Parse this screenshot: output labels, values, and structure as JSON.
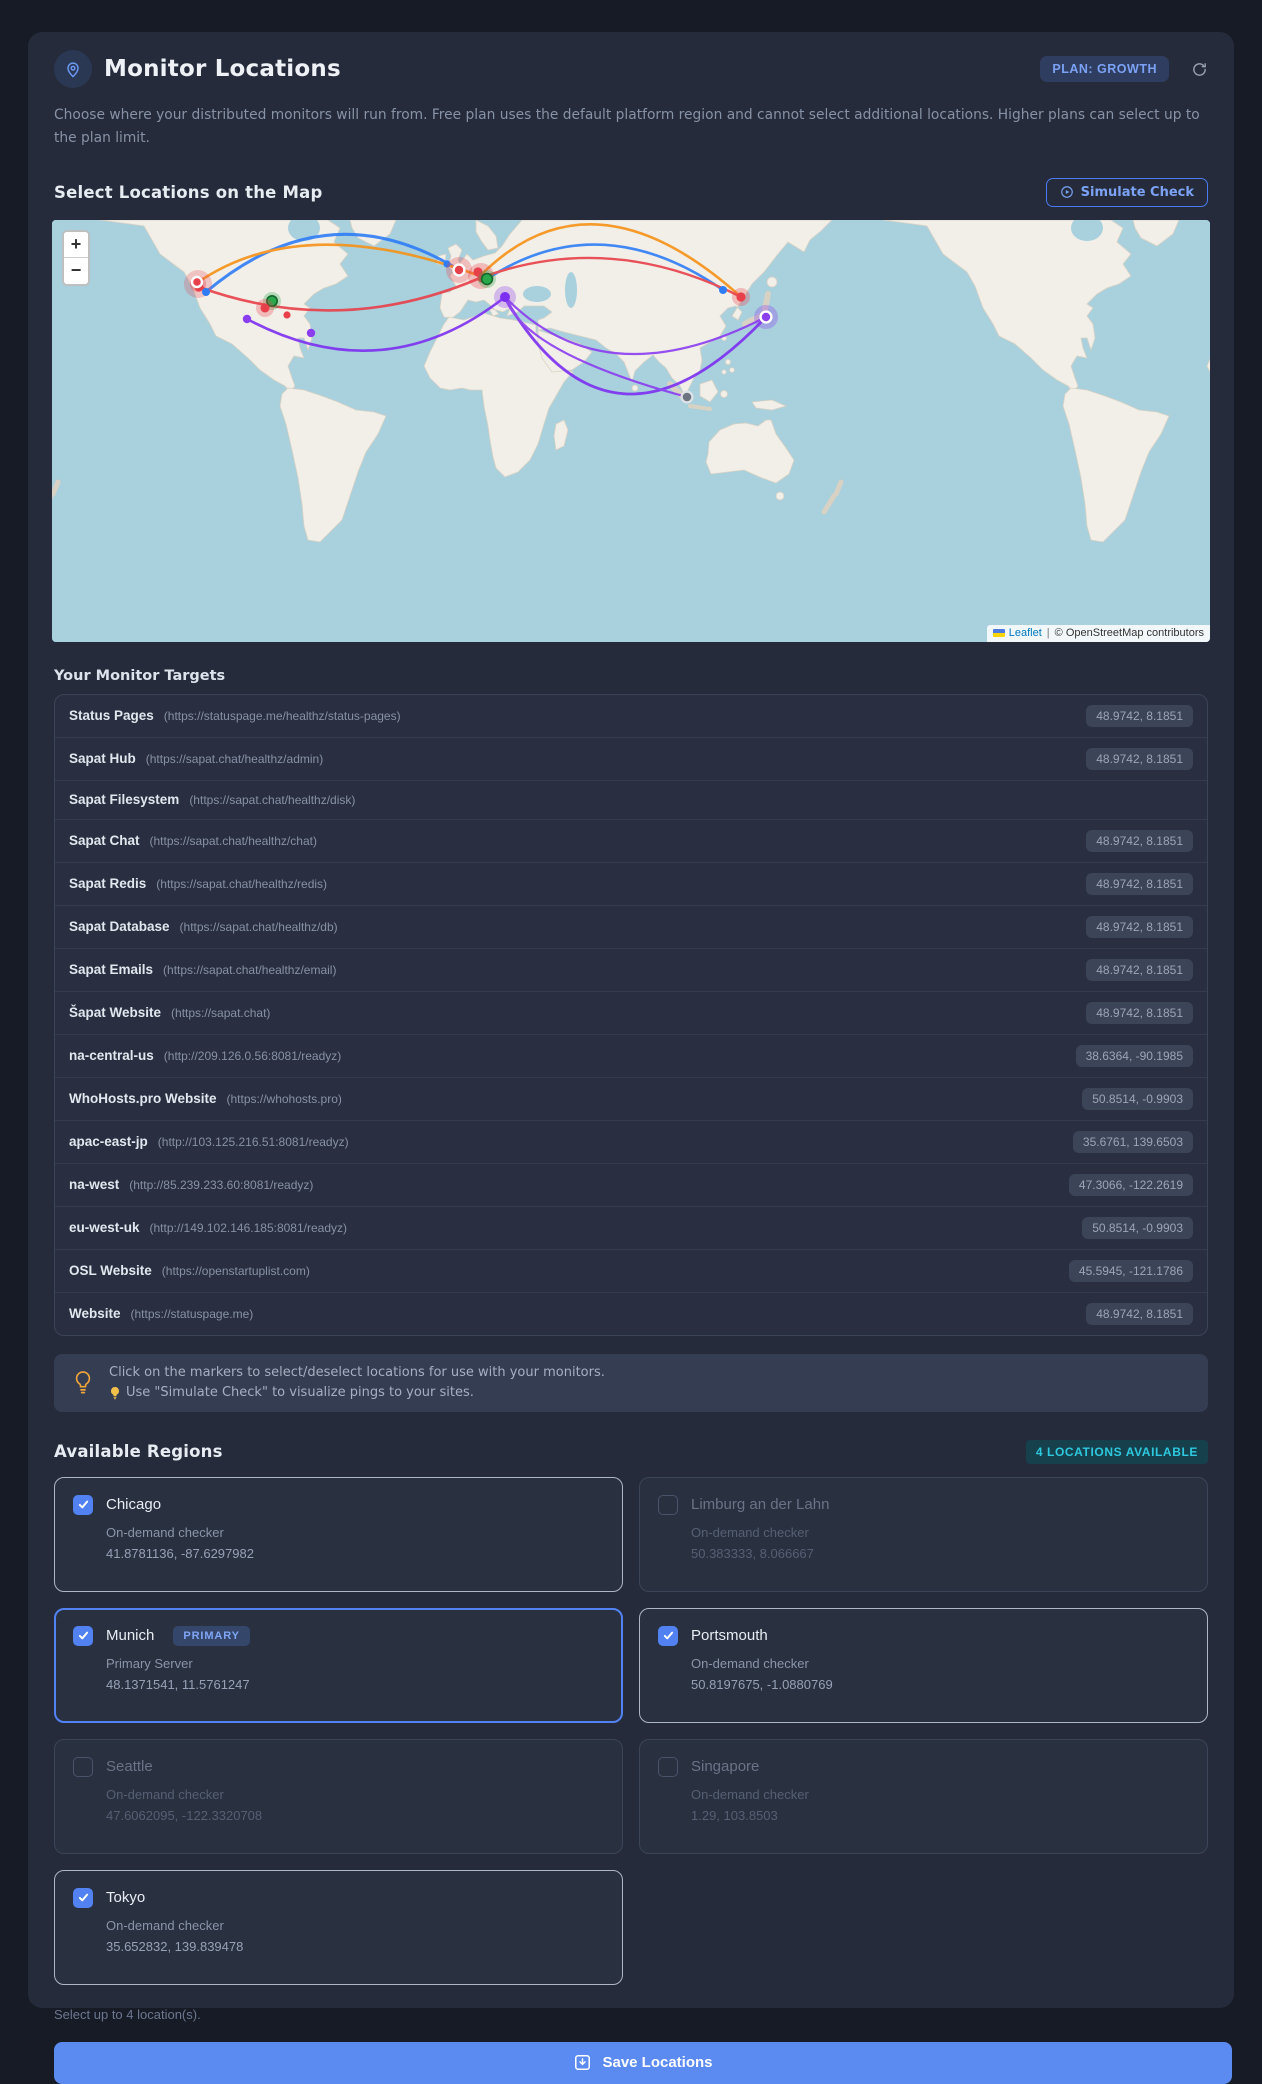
{
  "header": {
    "title": "Monitor Locations",
    "plan_badge": "PLAN: GROWTH",
    "description": "Choose where your distributed monitors will run from. Free plan uses the default platform region and cannot select additional locations. Higher plans can select up to the plan limit."
  },
  "map_section": {
    "heading": "Select Locations on the Map",
    "simulate_button": "Simulate Check",
    "zoom_in": "+",
    "zoom_out": "−",
    "attribution": {
      "leaflet": "Leaflet",
      "separator": "|",
      "osm": "© OpenStreetMap contributors"
    }
  },
  "targets": {
    "heading": "Your Monitor Targets",
    "items": [
      {
        "name": "Status Pages",
        "url": "(https://statuspage.me/healthz/status-pages)",
        "coords": "48.9742, 8.1851"
      },
      {
        "name": "Sapat Hub",
        "url": "(https://sapat.chat/healthz/admin)",
        "coords": "48.9742, 8.1851"
      },
      {
        "name": "Sapat Filesystem",
        "url": "(https://sapat.chat/healthz/disk)",
        "coords": ""
      },
      {
        "name": "Sapat Chat",
        "url": "(https://sapat.chat/healthz/chat)",
        "coords": "48.9742, 8.1851"
      },
      {
        "name": "Sapat Redis",
        "url": "(https://sapat.chat/healthz/redis)",
        "coords": "48.9742, 8.1851"
      },
      {
        "name": "Sapat Database",
        "url": "(https://sapat.chat/healthz/db)",
        "coords": "48.9742, 8.1851"
      },
      {
        "name": "Sapat Emails",
        "url": "(https://sapat.chat/healthz/email)",
        "coords": "48.9742, 8.1851"
      },
      {
        "name": "Šapat Website",
        "url": "(https://sapat.chat)",
        "coords": "48.9742, 8.1851"
      },
      {
        "name": "na-central-us",
        "url": "(http://209.126.0.56:8081/readyz)",
        "coords": "38.6364, -90.1985"
      },
      {
        "name": "WhoHosts.pro Website",
        "url": "(https://whohosts.pro)",
        "coords": "50.8514, -0.9903"
      },
      {
        "name": "apac-east-jp",
        "url": "(http://103.125.216.51:8081/readyz)",
        "coords": "35.6761, 139.6503"
      },
      {
        "name": "na-west",
        "url": "(http://85.239.233.60:8081/readyz)",
        "coords": "47.3066, -122.2619"
      },
      {
        "name": "eu-west-uk",
        "url": "(http://149.102.146.185:8081/readyz)",
        "coords": "50.8514, -0.9903"
      },
      {
        "name": "OSL Website",
        "url": "(https://openstartuplist.com)",
        "coords": "45.5945, -121.1786"
      },
      {
        "name": "Website",
        "url": "(https://statuspage.me)",
        "coords": "48.9742, 8.1851"
      }
    ]
  },
  "tip": {
    "line1": "Click on the markers to select/deselect locations for use with your monitors.",
    "line2": "Use \"Simulate Check\" to visualize pings to your sites."
  },
  "regions": {
    "heading": "Available Regions",
    "availability_badge": "4 LOCATIONS AVAILABLE",
    "cards": [
      {
        "name": "Chicago",
        "subtitle": "On-demand checker",
        "coords": "41.8781136, -87.6297982",
        "checked": true,
        "primary": false,
        "badge": ""
      },
      {
        "name": "Limburg an der Lahn",
        "subtitle": "On-demand checker",
        "coords": "50.383333, 8.066667",
        "checked": false,
        "primary": false,
        "badge": ""
      },
      {
        "name": "Munich",
        "subtitle": "Primary Server",
        "coords": "48.1371541, 11.5761247",
        "checked": true,
        "primary": true,
        "badge": "PRIMARY"
      },
      {
        "name": "Portsmouth",
        "subtitle": "On-demand checker",
        "coords": "50.8197675, -1.0880769",
        "checked": true,
        "primary": false,
        "badge": ""
      },
      {
        "name": "Seattle",
        "subtitle": "On-demand checker",
        "coords": "47.6062095, -122.3320708",
        "checked": false,
        "primary": false,
        "badge": ""
      },
      {
        "name": "Singapore",
        "subtitle": "On-demand checker",
        "coords": "1.29, 103.8503",
        "checked": false,
        "primary": false,
        "badge": ""
      },
      {
        "name": "Tokyo",
        "subtitle": "On-demand checker",
        "coords": "35.652832, 139.839478",
        "checked": true,
        "primary": false,
        "badge": ""
      }
    ],
    "footnote": "Select up to 4 location(s).",
    "save_button": "Save Locations"
  }
}
